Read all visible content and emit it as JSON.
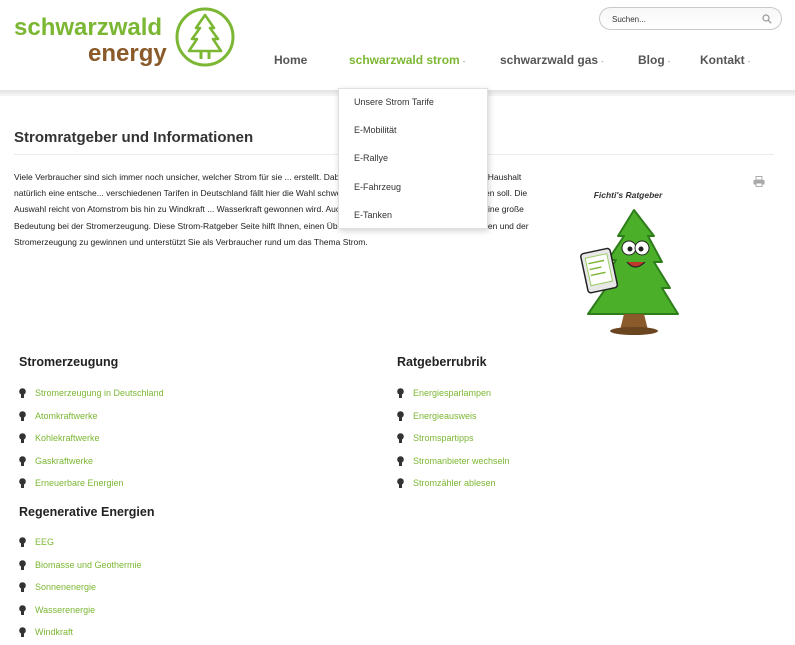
{
  "logo": {
    "word1": "schwarzwald",
    "word2": "energy"
  },
  "search": {
    "placeholder": "Suchen..."
  },
  "nav": {
    "items": [
      {
        "label": "Home"
      },
      {
        "label": "schwarzwald strom"
      },
      {
        "label": "schwarzwald gas"
      },
      {
        "label": "Blog"
      },
      {
        "label": "Kontakt"
      }
    ],
    "caret": "-"
  },
  "dropdown": {
    "items": [
      "Unsere Strom Tarife",
      "E-Mobilität",
      "E-Rallye",
      "E-Fahrzeug",
      "E-Tanken"
    ]
  },
  "page": {
    "title": "Stromratgeber und Informationen",
    "intro": "Viele Verbraucher sind sich immer noch unsicher, welcher Strom für sie ... erstellt. Dabei spielen die Kosten für den einzelnen Haushalt natürlich eine entsche... verschiedenen Tarifen in Deutschland fällt hier die Wahl schwer. Dazu stellt sich die ... sich entscheiden soll. Die Auswahl reicht von Atomstrom bis hin zu Windkraft ... Wasserkraft gewonnen wird. Auch Kohlekraftwerke haben immer noch eine große Bedeutung bei der Stromerzeugung. Diese Strom-Ratgeber Seite hilft Ihnen, einen Überblick über die verschiedenen Stromarten und der Stromerzeugung zu gewinnen und unterstützt Sie als Verbraucher rund um das Thema Strom."
  },
  "mascot": {
    "caption": "Fichti's Ratgeber"
  },
  "sections": {
    "stromerzeugung": {
      "heading": "Stromerzeugung",
      "links": [
        "Stromerzeugung in Deutschland",
        "Atomkraftwerke",
        "Kohlekraftwerke",
        "Gaskraftwerke",
        "Erneuerbare Energien"
      ]
    },
    "ratgeberrubrik": {
      "heading": "Ratgeberrubrik",
      "links": [
        "Energiesparlampen",
        "Energieausweis",
        "Stromspartipps",
        "Stromanbieter wechseln",
        "Stromzähler ablesen"
      ]
    },
    "regenerative": {
      "heading": "Regenerative Energien",
      "links": [
        "EEG",
        "Biomasse und Geothermie",
        "Sonnenenergie",
        "Wasserenergie",
        "Windkraft"
      ]
    }
  },
  "colors": {
    "accent": "#7cb733",
    "brown": "#8a5a2b",
    "text": "#222222"
  }
}
